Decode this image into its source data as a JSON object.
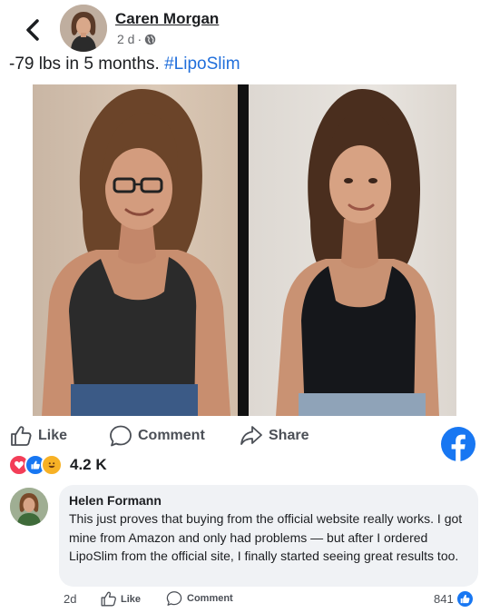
{
  "post": {
    "author": "Caren Morgan",
    "age": "2 d",
    "text_main": "-79 lbs in 5 months. ",
    "hashtag": "#LipoSlim"
  },
  "actions": {
    "like": "Like",
    "comment": "Comment",
    "share": "Share"
  },
  "reactions": {
    "count": "4.2 K",
    "types": [
      "love",
      "like",
      "haha"
    ]
  },
  "comment": {
    "name": "Helen Formann",
    "text": "This just proves that buying from the official website really works. I got mine from Amazon and only had problems — but after I ordered LipoSlim from the official site, I finally started seeing great results too.",
    "age": "2d",
    "like": "Like",
    "comment": "Comment",
    "like_count": "841"
  },
  "colors": {
    "brand_blue": "#1877f2",
    "hashtag": "#216fdb",
    "love_red": "#f33e58",
    "haha_yellow": "#f7b125",
    "secondary_text": "#65676b",
    "bubble_bg": "#f0f2f5"
  },
  "icons": [
    "chevron-left-icon",
    "globe-icon",
    "thumbs-up-icon",
    "comment-bubble-icon",
    "share-arrow-icon",
    "facebook-logo-icon",
    "love-reaction-icon",
    "like-reaction-icon",
    "haha-reaction-icon"
  ]
}
